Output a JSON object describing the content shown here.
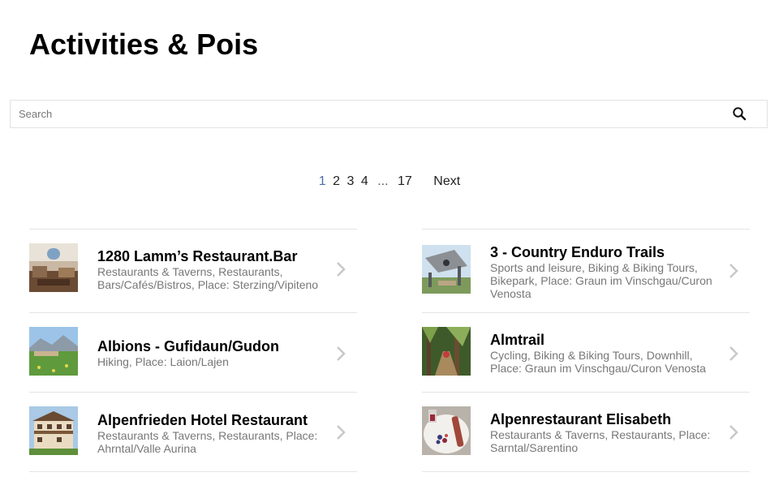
{
  "page": {
    "title": "Activities & Pois"
  },
  "search": {
    "placeholder": "Search",
    "value": ""
  },
  "pagination": {
    "pages": [
      "1",
      "2",
      "3",
      "4"
    ],
    "ellipsis": "...",
    "last_page": "17",
    "next_label": "Next",
    "current": "1"
  },
  "colors": {
    "pager_current": "#4a6fa5",
    "meta_text": "#777777",
    "divider": "#e4e4e4"
  },
  "left_list": [
    {
      "name": "1280 Lamm’s Restaurant.Bar",
      "categories": "Restaurants & Taverns, Restaurants, Bars/Cafés/Bistros, Place: Sterzing/Vipiteno",
      "thumbnail": "restaurant-interior"
    },
    {
      "name": "Albions - Gufidaun/Gudon",
      "categories": "Hiking, Place: Laion/Lajen",
      "thumbnail": "alpine-meadow"
    },
    {
      "name": "Alpenfrieden Hotel Restaurant",
      "categories": "Restaurants & Taverns, Restaurants, Place: Ahrntal/Valle Aurina",
      "thumbnail": "hotel-building"
    }
  ],
  "right_list": [
    {
      "name": "3 - Country Enduro Trails",
      "categories": "Sports and leisure, Biking & Biking Tours, Bikepark, Place: Graun im Vinschgau/Curon Venosta",
      "thumbnail": "bike-ramp"
    },
    {
      "name": "Almtrail",
      "categories": "Cycling, Biking & Biking Tours, Downhill, Place: Graun im Vinschgau/Curon Venosta",
      "thumbnail": "forest-trail"
    },
    {
      "name": "Alpenrestaurant Elisabeth",
      "categories": "Restaurants & Taverns, Restaurants, Place: Sarntal/Sarentino",
      "thumbnail": "dessert-plate"
    }
  ]
}
